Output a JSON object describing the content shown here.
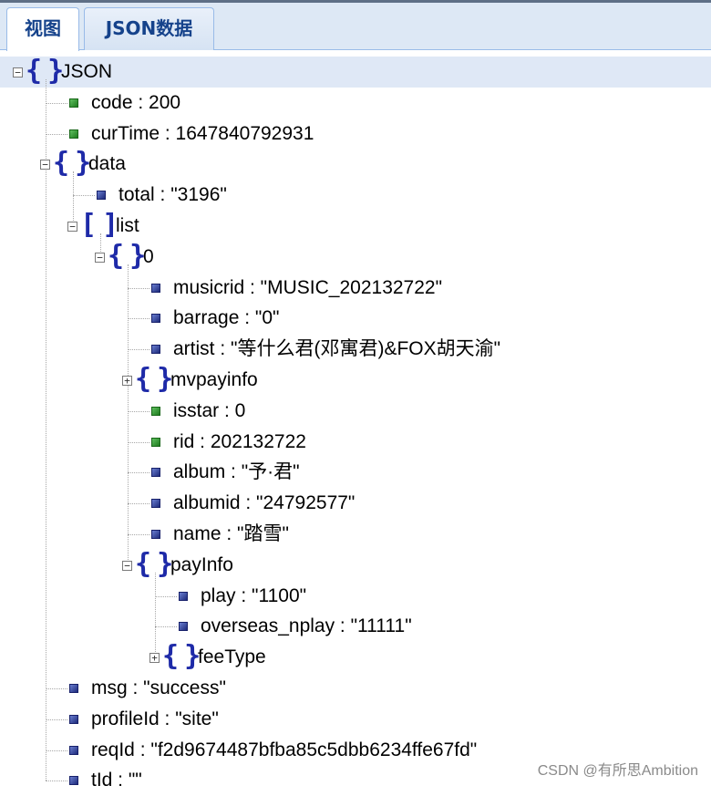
{
  "tabs": [
    {
      "label": "视图",
      "active": true
    },
    {
      "label": "JSON数据",
      "active": false
    }
  ],
  "tree": [
    {
      "text": "JSON",
      "type": "object",
      "depth": 0,
      "toggle": "⊟"
    },
    {
      "text": "code : 200",
      "type": "number",
      "depth": 1
    },
    {
      "text": "curTime : 1647840792931",
      "type": "number",
      "depth": 1
    },
    {
      "text": "data",
      "type": "object",
      "depth": 1,
      "toggle": "⊟"
    },
    {
      "text": "total : \"3196\"",
      "type": "string",
      "depth": 2
    },
    {
      "text": "list",
      "type": "array",
      "depth": 2,
      "toggle": "⊟"
    },
    {
      "text": "0",
      "type": "object",
      "depth": 3,
      "toggle": "⊟"
    },
    {
      "text": "musicrid : \"MUSIC_202132722\"",
      "type": "string",
      "depth": 4
    },
    {
      "text": "barrage : \"0\"",
      "type": "string",
      "depth": 4
    },
    {
      "text": "artist : \"等什么君(邓寓君)&FOX胡天渝\"",
      "type": "string",
      "depth": 4
    },
    {
      "text": "mvpayinfo",
      "type": "object",
      "depth": 4,
      "toggle": "⊞"
    },
    {
      "text": "isstar : 0",
      "type": "number",
      "depth": 4
    },
    {
      "text": "rid : 202132722",
      "type": "number",
      "depth": 4
    },
    {
      "text": "album : \"予·君\"",
      "type": "string",
      "depth": 4
    },
    {
      "text": "albumid : \"24792577\"",
      "type": "string",
      "depth": 4
    },
    {
      "text": "name : \"踏雪\"",
      "type": "string",
      "depth": 4
    },
    {
      "text": "payInfo",
      "type": "object",
      "depth": 4,
      "toggle": "⊟"
    },
    {
      "text": "play : \"1100\"",
      "type": "string",
      "depth": 5
    },
    {
      "text": "overseas_nplay : \"11111\"",
      "type": "string",
      "depth": 5
    },
    {
      "text": "feeType",
      "type": "object",
      "depth": 5,
      "toggle": "⊞"
    },
    {
      "text": "msg : \"success\"",
      "type": "string",
      "depth": 1
    },
    {
      "text": "profileId : \"site\"",
      "type": "string",
      "depth": 1
    },
    {
      "text": "reqId : \"f2d9674487bfba85c5dbb6234ffe67fd\"",
      "type": "string",
      "depth": 1
    },
    {
      "text": "tId : \"\"",
      "type": "string",
      "depth": 1
    }
  ],
  "watermark": "CSDN @有所思Ambition",
  "colors": {
    "number_node": "#2e8b2e",
    "string_node": "#1d2a7a",
    "brace": "#1e2aa8",
    "tab_text": "#15428b"
  }
}
